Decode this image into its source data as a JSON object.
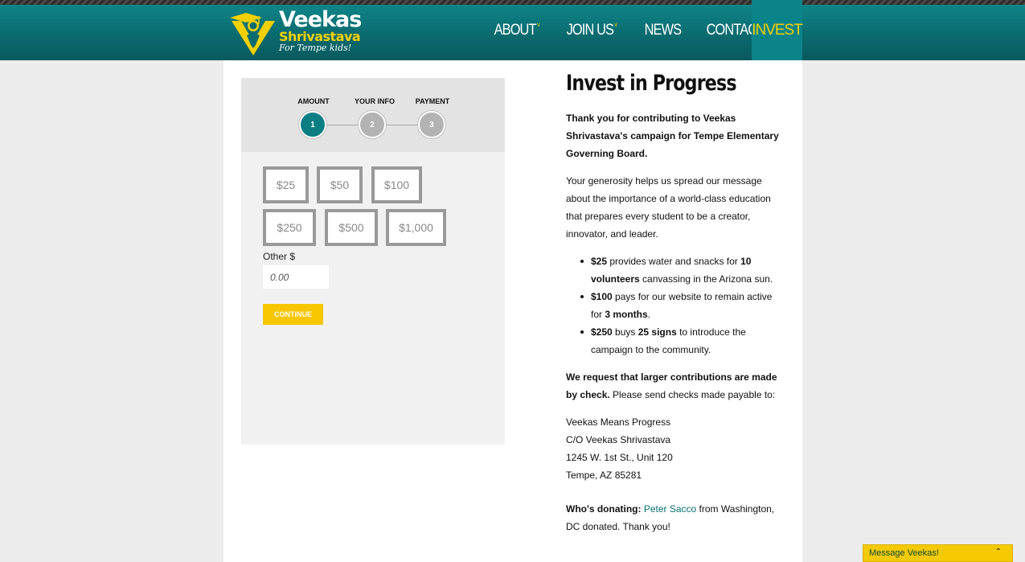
{
  "brand": {
    "name": "Veekas",
    "surname": "Shrivastava",
    "tagline": "For Tempe kids!"
  },
  "nav": {
    "items": [
      {
        "label": "ABOUT",
        "caret": "˅"
      },
      {
        "label": "JOIN US",
        "caret": "˅"
      },
      {
        "label": "NEWS",
        "caret": ""
      },
      {
        "label": "CONTACT",
        "caret": "˅"
      }
    ],
    "active": "INVEST"
  },
  "steps": [
    {
      "label": "AMOUNT",
      "number": "1",
      "state": "active"
    },
    {
      "label": "YOUR INFO",
      "number": "2",
      "state": "inactive"
    },
    {
      "label": "PAYMENT",
      "number": "3",
      "state": "inactive"
    }
  ],
  "amounts": [
    "$25",
    "$50",
    "$100",
    "$250",
    "$500",
    "$1,000"
  ],
  "other": {
    "label": "Other $",
    "placeholder": "0.00"
  },
  "continue_label": "CONTINUE",
  "article": {
    "title": "Invest in Progress",
    "intro": "Thank you for contributing to Veekas Shrivastava's campaign for Tempe Elementary Governing Board.",
    "para2": "Your generosity helps us spread our message about the importance of a world-class education that prepares every student to be a creator, innovator, and leader.",
    "bullets": [
      {
        "amount": "$25",
        "pre": " provides water and snacks for ",
        "bold": "10 volunteers",
        "post": " canvassing in the Arizona sun."
      },
      {
        "amount": "$100",
        "pre": " pays for our website to remain active for ",
        "bold": "3 months",
        "post": "."
      },
      {
        "amount": "$250",
        "pre": " buys ",
        "bold": "25 signs",
        "post": " to introduce the campaign to the community."
      }
    ],
    "check_bold": "We request that larger contributions are made by check.",
    "check_rest": " Please send checks made payable to:",
    "address": [
      "Veekas Means Progress",
      "C/O Veekas Shrivastava",
      "1245 W. 1st St., Unit 120",
      "Tempe, AZ 85281"
    ],
    "donating_label": "Who's donating:",
    "donor_name": "Peter Sacco",
    "donor_rest": " from Washington, DC donated. Thank you!"
  },
  "colors": {
    "teal": "#0b7e83",
    "yellow": "#f5ca00"
  },
  "message_bar": {
    "label": "Message Veekas!",
    "icon": "chevron-up-icon"
  }
}
